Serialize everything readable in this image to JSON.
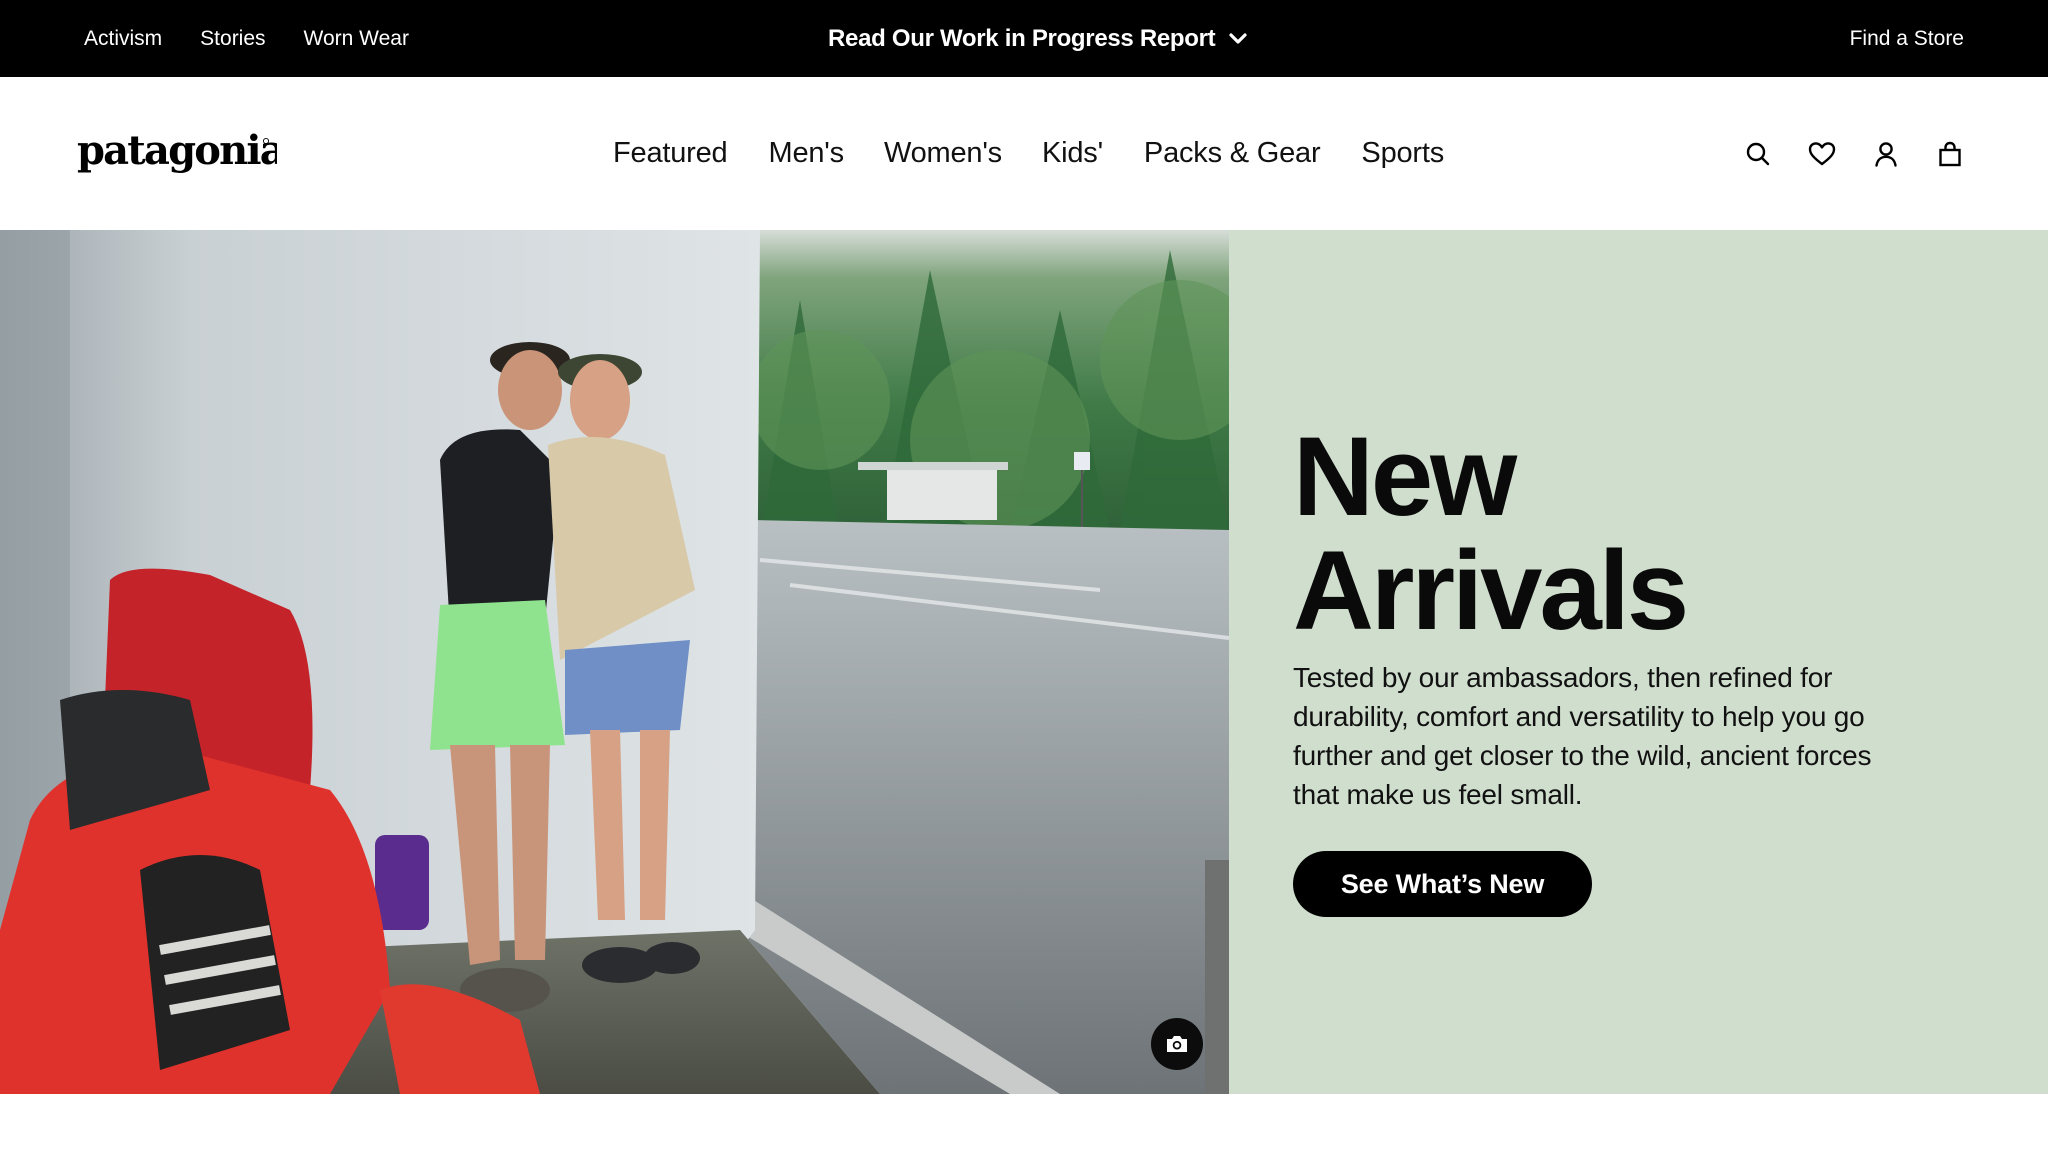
{
  "utility_bar": {
    "links": [
      "Activism",
      "Stories",
      "Worn Wear"
    ],
    "announcement": "Read Our Work in Progress Report",
    "find_store": "Find a Store"
  },
  "header": {
    "logo_text": "patagonia",
    "nav": [
      "Featured",
      "Men's",
      "Women's",
      "Kids'",
      "Packs & Gear",
      "Sports"
    ],
    "icons": [
      "search-icon",
      "heart-icon",
      "account-icon",
      "bag-icon"
    ]
  },
  "hero": {
    "title_line1": "New",
    "title_line2": "Arrivals",
    "description": "Tested by our ambassadors, then refined for durability, comfort and versatility to help you go further and get closer to the wild, ancient forces that make us feel small.",
    "cta_label": "See What’s New",
    "photo_icon": "camera-icon",
    "panel_color": "#d0dece"
  }
}
